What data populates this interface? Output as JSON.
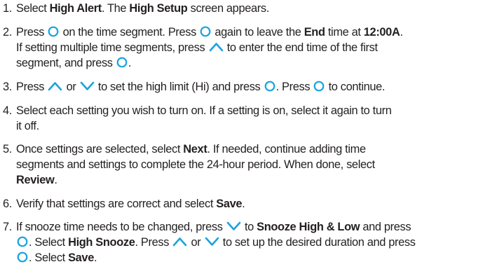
{
  "steps": [
    {
      "number": "1.",
      "parts": [
        {
          "t": "Select "
        },
        {
          "b": "High Alert"
        },
        {
          "t": ". The "
        },
        {
          "b": "High Setup"
        },
        {
          "t": " screen appears."
        }
      ]
    },
    {
      "number": "2.",
      "parts": [
        {
          "t": "Press "
        },
        {
          "icon": "select-circle-icon"
        },
        {
          "t": " on the time segment. Press "
        },
        {
          "icon": "select-circle-icon"
        },
        {
          "t": " again to leave the "
        },
        {
          "b": "End"
        },
        {
          "t": " time at "
        },
        {
          "b": "12:00A"
        },
        {
          "t": "."
        },
        {
          "br": true
        },
        {
          "t": "If setting multiple time segments, press "
        },
        {
          "icon": "up-arrow-icon"
        },
        {
          "t": " to enter the end time of the first"
        },
        {
          "br": true
        },
        {
          "t": "segment, and press "
        },
        {
          "icon": "select-circle-icon"
        },
        {
          "t": "."
        }
      ]
    },
    {
      "number": "3.",
      "parts": [
        {
          "t": "Press "
        },
        {
          "icon": "up-arrow-icon"
        },
        {
          "t": " or "
        },
        {
          "icon": "down-arrow-icon"
        },
        {
          "t": " to set the high limit (Hi) and press "
        },
        {
          "icon": "select-circle-icon"
        },
        {
          "t": ". Press "
        },
        {
          "icon": "select-circle-icon"
        },
        {
          "t": " to continue."
        }
      ]
    },
    {
      "number": "4.",
      "parts": [
        {
          "t": "Select each setting you wish to turn on. If a setting is on, select it again to turn"
        },
        {
          "br": true
        },
        {
          "t": "it off."
        }
      ]
    },
    {
      "number": "5.",
      "parts": [
        {
          "t": "Once settings are selected, select "
        },
        {
          "b": "Next"
        },
        {
          "t": ". If needed, continue adding time"
        },
        {
          "br": true
        },
        {
          "t": "segments and settings to complete the 24-hour period. When done, select"
        },
        {
          "br": true
        },
        {
          "b": "Review"
        },
        {
          "t": "."
        }
      ]
    },
    {
      "number": "6.",
      "parts": [
        {
          "t": "Verify that settings are correct and select "
        },
        {
          "b": "Save"
        },
        {
          "t": "."
        }
      ]
    },
    {
      "number": "7.",
      "parts": [
        {
          "t": "If snooze time needs to be changed, press "
        },
        {
          "icon": "down-arrow-icon"
        },
        {
          "t": " to "
        },
        {
          "b": "Snooze High & Low"
        },
        {
          "t": " and press"
        },
        {
          "br": true
        },
        {
          "icon": "select-circle-icon"
        },
        {
          "t": ". Select "
        },
        {
          "b": "High Snooze"
        },
        {
          "t": ". Press "
        },
        {
          "icon": "up-arrow-icon"
        },
        {
          "t": " or "
        },
        {
          "icon": "down-arrow-icon"
        },
        {
          "t": " to set up the desired duration and press"
        },
        {
          "br": true
        },
        {
          "icon": "select-circle-icon"
        },
        {
          "t": ". Select "
        },
        {
          "b": "Save"
        },
        {
          "t": "."
        }
      ]
    }
  ],
  "colors": {
    "icon": "#1aa3de",
    "text": "#231f20"
  }
}
